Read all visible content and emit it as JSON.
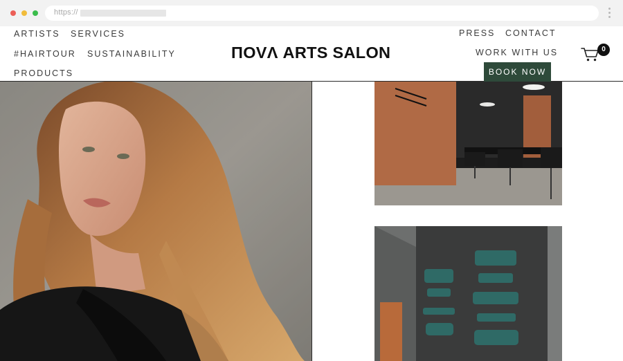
{
  "browser": {
    "url_prefix": "https://"
  },
  "header": {
    "nav_left": [
      "ARTISTS",
      "SERVICES",
      "#HAIRTOUR",
      "SUSTAINABILITY",
      "PRODUCTS"
    ],
    "nav_right": [
      "PRESS",
      "CONTACT",
      "WORK WITH US"
    ],
    "logo": "ПOVΛ ARTS SALON",
    "book_button": "BOOK NOW",
    "cart_count": "0"
  },
  "colors": {
    "accent_green": "#2e4a3a",
    "text": "#3a3a3a"
  },
  "icons": [
    "cart-icon",
    "kebab-menu-icon"
  ]
}
